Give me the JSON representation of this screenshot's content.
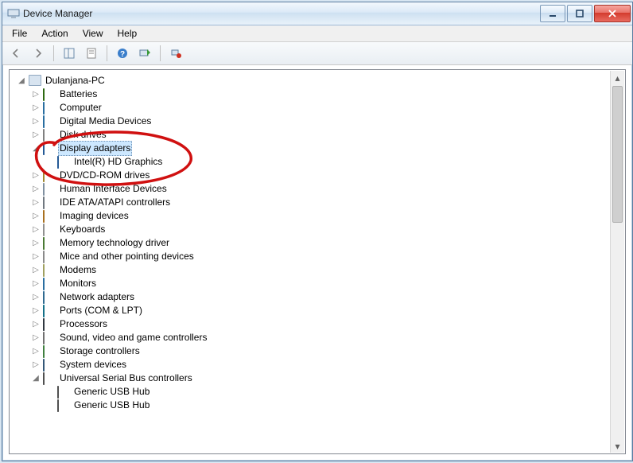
{
  "window": {
    "title": "Device Manager"
  },
  "menu": {
    "file": "File",
    "action": "Action",
    "view": "View",
    "help": "Help"
  },
  "tree": {
    "root": "Dulanjana-PC",
    "batteries": "Batteries",
    "computer": "Computer",
    "digital_media": "Digital Media Devices",
    "disk_drives": "Disk drives",
    "display_adapters": "Display adapters",
    "display_child1": "Intel(R) HD Graphics",
    "dvd": "DVD/CD-ROM drives",
    "hid": "Human Interface Devices",
    "ide": "IDE ATA/ATAPI controllers",
    "imaging": "Imaging devices",
    "keyboards": "Keyboards",
    "memory": "Memory technology driver",
    "mice": "Mice and other pointing devices",
    "modems": "Modems",
    "monitors": "Monitors",
    "network": "Network adapters",
    "ports": "Ports (COM & LPT)",
    "processors": "Processors",
    "sound": "Sound, video and game controllers",
    "storage": "Storage controllers",
    "system": "System devices",
    "usb": "Universal Serial Bus controllers",
    "usb_child1": "Generic USB Hub",
    "usb_child2": "Generic USB Hub"
  }
}
